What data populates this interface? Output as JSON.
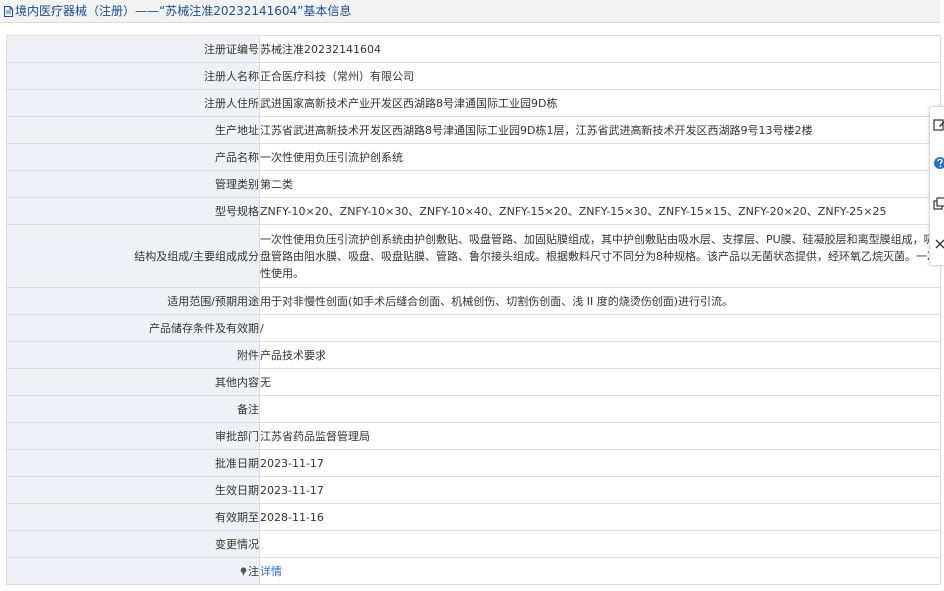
{
  "header": {
    "title": "境内医疗器械（注册）——“苏械注准20232141604”基本信息"
  },
  "rows": [
    {
      "label": "注册证编号",
      "value": "苏械注准20232141604"
    },
    {
      "label": "注册人名称",
      "value": "正合医疗科技（常州）有限公司"
    },
    {
      "label": "注册人住所",
      "value": "武进国家高新技术产业开发区西湖路8号津通国际工业园9D栋"
    },
    {
      "label": "生产地址",
      "value": "江苏省武进高新技术开发区西湖路8号津通国际工业园9D栋1层，江苏省武进高新技术开发区西湖路9号13号楼2楼"
    },
    {
      "label": "产品名称",
      "value": "一次性使用负压引流护创系统"
    },
    {
      "label": "管理类别",
      "value": "第二类"
    },
    {
      "label": "型号规格",
      "value": "ZNFY-10×20、ZNFY-10×30、ZNFY-10×40、ZNFY-15×20、ZNFY-15×30、ZNFY-15×15、ZNFY-20×20、ZNFY-25×25"
    },
    {
      "label": "结构及组成/主要组成成分",
      "value": "一次性使用负压引流护创系统由护创敷贴、吸盘管路、加固贴膜组成，其中护创敷贴由吸水层、支撑层、PU膜、硅凝胶层和离型膜组成，吸盘管路由阻水膜、吸盘、吸盘贴膜、管路、鲁尔接头组成。根据敷料尺寸不同分为8种规格。该产品以无菌状态提供，经环氧乙烷灭菌。一次性使用。"
    },
    {
      "label": "适用范围/预期用途",
      "value": "用于对非慢性创面(如手术后缝合创面、机械创伤、切割伤创面、浅 II 度的烧烫伤创面)进行引流。"
    },
    {
      "label": "产品储存条件及有效期",
      "value": "/"
    },
    {
      "label": "附件",
      "value": "产品技术要求"
    },
    {
      "label": "其他内容",
      "value": "无"
    },
    {
      "label": "备注",
      "value": ""
    },
    {
      "label": "审批部门",
      "value": "江苏省药品监督管理局"
    },
    {
      "label": "批准日期",
      "value": "2023-11-17"
    },
    {
      "label": "生效日期",
      "value": "2023-11-17"
    },
    {
      "label": "有效期至",
      "value": "2028-11-16"
    },
    {
      "label": "变更情况",
      "value": ""
    }
  ],
  "note_row": {
    "label": "注",
    "link_text": "详情"
  },
  "icons": {
    "title": "document-icon",
    "note": "pin-icon",
    "toolbar": [
      "edit-icon",
      "help-icon",
      "copy-icon",
      "close-icon"
    ]
  },
  "colors": {
    "title_text": "#1f4e8c",
    "label_bg": "#eef1f5",
    "border": "#dcdcdc",
    "link": "#2a6fc2",
    "header_bg": "#f2f2f2"
  }
}
